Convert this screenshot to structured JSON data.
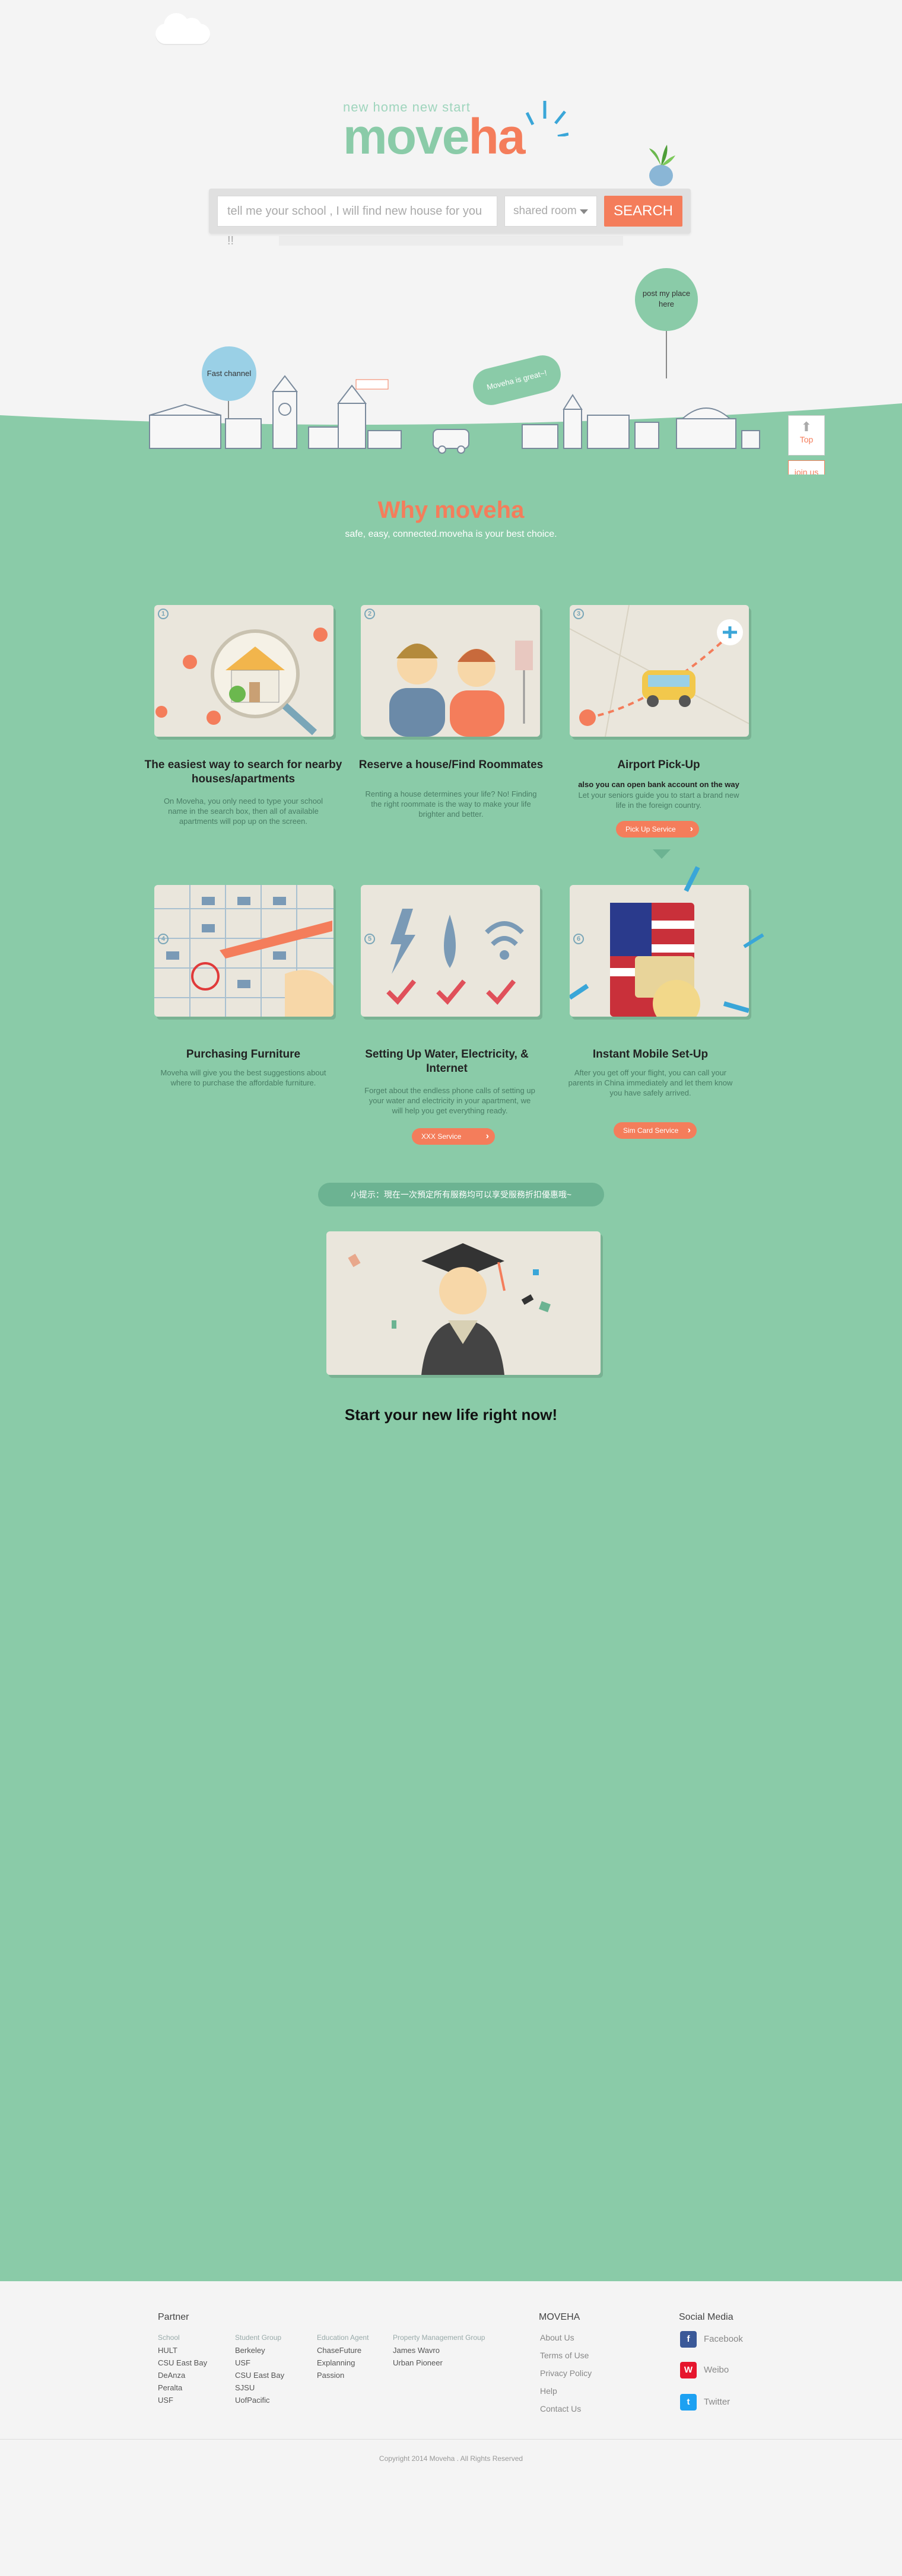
{
  "header": {
    "tagline": "new home new start",
    "logo_part1": "move",
    "logo_part2": "ha"
  },
  "search": {
    "placeholder": "tell me your school , I will find new house for you !!",
    "room_type": "shared room",
    "button": "SEARCH"
  },
  "hero": {
    "fast_channel": "Fast channel",
    "post_place": "post my place here",
    "speech": "Moveha is great~!",
    "side_top": "Top",
    "side_join": "join us"
  },
  "why": {
    "title": "Why moveha",
    "subtitle": "safe, easy, connected.moveha is your best choice."
  },
  "features": [
    {
      "num": "1",
      "title": "The easiest way to search for nearby houses/apartments",
      "desc": "On Moveha, you only need to type your school name in the search box, then all of available apartments will pop up on the screen."
    },
    {
      "num": "2",
      "title": "Reserve a house/Find Roommates",
      "desc": "Renting a house determines your life? No! Finding the right roommate is the way to make your life brighter and better."
    },
    {
      "num": "3",
      "title": "Airport Pick-Up",
      "desc_bold": "also you can open bank account on the way",
      "desc": "Let your seniors guide you to start a brand new life in the foreign country.",
      "button": "Pick Up Service"
    },
    {
      "num": "4",
      "title": "Purchasing Furniture",
      "desc": "Moveha will give you the best suggestions about where to purchase the affordable furniture."
    },
    {
      "num": "5",
      "title": "Setting Up Water, Electricity, & Internet",
      "desc": "Forget about the endless phone calls of setting up your water and electricity in your apartment, we will help you get everything ready.",
      "button": "XXX Service"
    },
    {
      "num": "6",
      "title": "Instant Mobile Set-Up",
      "desc": "After you get off your flight, you can call your parents in China immediately and let them know you have safely arrived.",
      "button": "Sim Card Service"
    }
  ],
  "tip": "小提示：現在一次預定所有服務均可以享受服務折扣優惠哦~",
  "start": "Start your new life right now!",
  "footer": {
    "partner_heading": "Partner",
    "columns": [
      {
        "heading": "School",
        "items": [
          "HULT",
          "CSU East Bay",
          "DeAnza",
          "Peralta",
          "USF"
        ]
      },
      {
        "heading": "Student Group",
        "items": [
          "Berkeley",
          "USF",
          "CSU East Bay",
          "SJSU",
          "UofPacific"
        ]
      },
      {
        "heading": "Education Agent",
        "items": [
          "ChaseFuture",
          "Explanning",
          "Passion"
        ]
      },
      {
        "heading": "Property Management Group",
        "items": [
          "James Wavro",
          "Urban Pioneer"
        ]
      }
    ],
    "moveha_heading": "MOVEHA",
    "moveha_links": [
      "About Us",
      "Terms of Use",
      "Privacy Policy",
      "Help",
      "Contact Us"
    ],
    "social_heading": "Social Media",
    "social": [
      "Facebook",
      "Weibo",
      "Twitter"
    ],
    "copyright": "Copyright 2014 Moveha . All Rights Reserved"
  },
  "colors": {
    "green": "#8acba8",
    "orange": "#f47d5b",
    "bg": "#f4f4f4"
  }
}
